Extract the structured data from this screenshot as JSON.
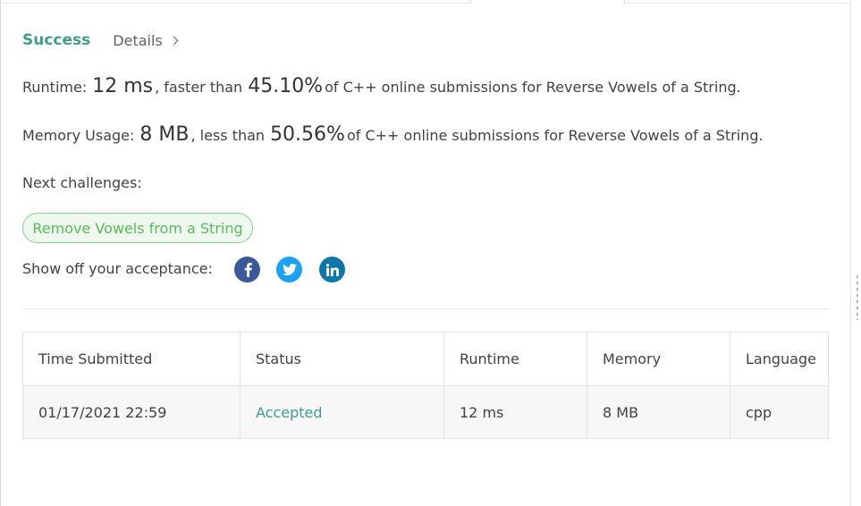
{
  "result": {
    "status": "Success",
    "details_label": "Details"
  },
  "runtime": {
    "label": "Runtime:",
    "value": "12 ms",
    "comparison": ", faster than",
    "percent": "45.10%",
    "suffix": "of C++ online submissions for Reverse Vowels of a String."
  },
  "memory": {
    "label": "Memory Usage:",
    "value": "8 MB",
    "comparison": ", less than",
    "percent": "50.56%",
    "suffix": "of C++ online submissions for Reverse Vowels of a String."
  },
  "next": {
    "label": "Next challenges:",
    "challenges": [
      "Remove Vowels from a String"
    ]
  },
  "share": {
    "label": "Show off your acceptance:",
    "icons": [
      "facebook-icon",
      "twitter-icon",
      "linkedin-icon"
    ]
  },
  "table": {
    "headers": [
      "Time Submitted",
      "Status",
      "Runtime",
      "Memory",
      "Language"
    ],
    "rows": [
      [
        "01/17/2021 22:59",
        "Accepted",
        "12 ms",
        "8 MB",
        "cpp"
      ]
    ]
  },
  "colors": {
    "success": "#3e9d8e",
    "challenge": "#5cb85c",
    "facebook": "#3b5998",
    "twitter": "#1da1f2",
    "linkedin": "#0e76a8"
  }
}
